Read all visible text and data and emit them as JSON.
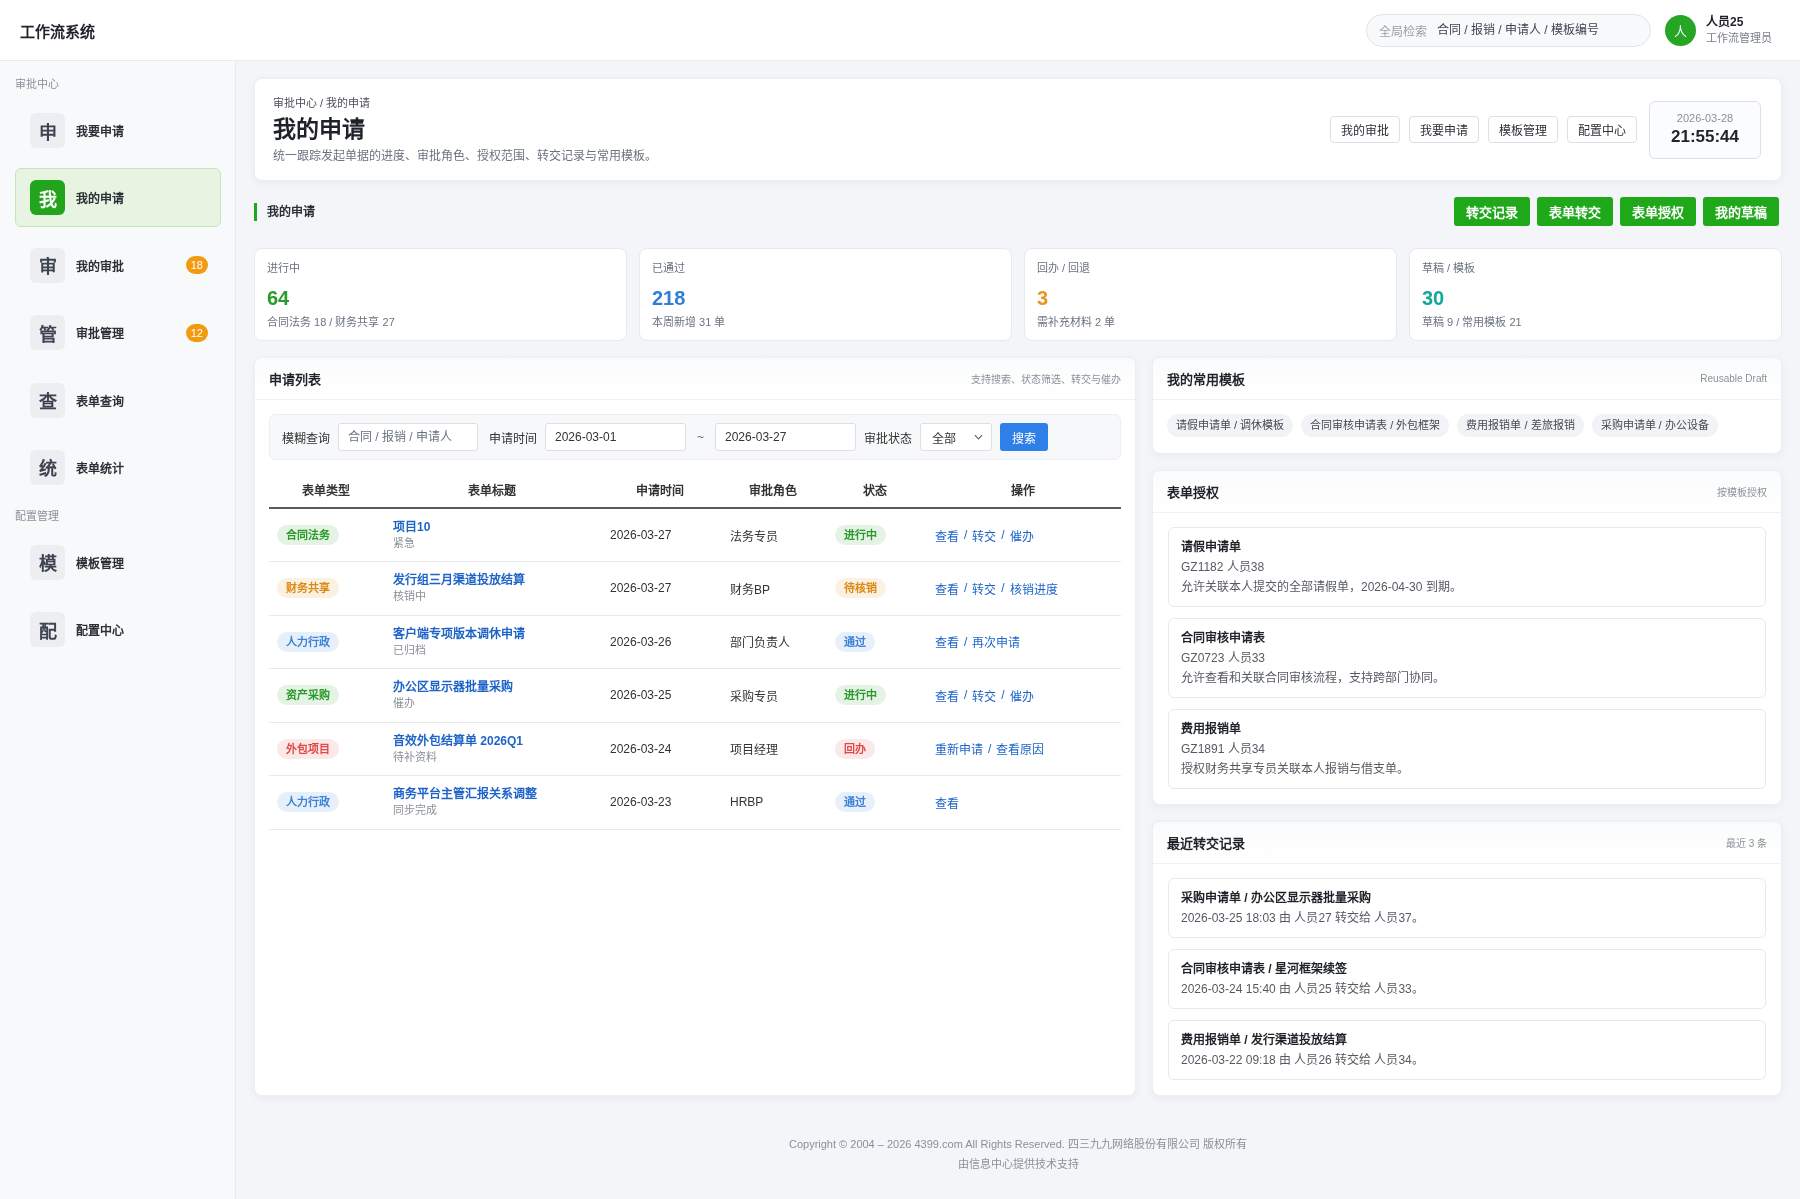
{
  "app": {
    "title": "工作流系统"
  },
  "global_search": {
    "label": "全局检索",
    "placeholder": "合同 / 报销 / 申请人 / 模板编号"
  },
  "user": {
    "avatar": "人",
    "name": "人员25",
    "role": "工作流管理员"
  },
  "sidebar": {
    "sections": [
      {
        "title": "审批中心",
        "items": [
          {
            "glyph": "申",
            "label": "我要申请",
            "selected": false
          },
          {
            "glyph": "我",
            "label": "我的申请",
            "selected": true
          },
          {
            "glyph": "审",
            "label": "我的审批",
            "badge": "18",
            "selected": false
          },
          {
            "glyph": "管",
            "label": "审批管理",
            "badge": "12",
            "selected": false
          },
          {
            "glyph": "查",
            "label": "表单查询",
            "selected": false
          },
          {
            "glyph": "统",
            "label": "表单统计",
            "selected": false
          }
        ]
      },
      {
        "title": "配置管理",
        "items": [
          {
            "glyph": "模",
            "label": "模板管理",
            "selected": false
          },
          {
            "glyph": "配",
            "label": "配置中心",
            "selected": false
          }
        ]
      }
    ]
  },
  "page_header": {
    "breadcrumb": "审批中心 / 我的申请",
    "title": "我的申请",
    "subtitle": "统一跟踪发起单据的进度、审批角色、授权范围、转交记录与常用模板。",
    "quick_links": [
      "我的审批",
      "我要申请",
      "模板管理",
      "配置中心"
    ],
    "clock": {
      "date": "2026-03-28",
      "time": "21:55:44"
    }
  },
  "section": {
    "title": "我的申请",
    "actions": [
      "转交记录",
      "表单转交",
      "表单授权",
      "我的草稿"
    ]
  },
  "stats": [
    {
      "label": "进行中",
      "value": "64",
      "note": "合同法务 18 / 财务共享 27",
      "color": "#2a9a2a"
    },
    {
      "label": "已通过",
      "value": "218",
      "note": "本周新增 31 单",
      "color": "#2f7fd6"
    },
    {
      "label": "回办 / 回退",
      "value": "3",
      "note": "需补充材料 2 单",
      "color": "#e8961e"
    },
    {
      "label": "草稿 / 模板",
      "value": "30",
      "note": "草稿 9 / 常用模板 21",
      "color": "#14a79a"
    }
  ],
  "application_list": {
    "title": "申请列表",
    "hint": "支持搜索、状态筛选、转交与催办",
    "filters": {
      "keyword_label": "模糊查询",
      "keyword_placeholder": "合同 / 报销 / 申请人",
      "date_label": "申请时间",
      "date_from": "2026-03-01",
      "range_separator": "~",
      "date_to": "2026-03-27",
      "status_label": "审批状态",
      "status_value": "全部",
      "search_button": "搜索"
    },
    "table": {
      "columns": [
        "表单类型",
        "表单标题",
        "申请时间",
        "审批角色",
        "状态",
        "操作"
      ],
      "action_separator": "/",
      "rows": [
        {
          "type": {
            "label": "合同法务",
            "color": "#2a9a2a"
          },
          "title": "项目10",
          "subtitle": "紧急",
          "date": "2026-03-27",
          "role": "法务专员",
          "status": {
            "label": "进行中",
            "color": "#2a9a2a"
          },
          "actions": [
            "查看",
            "转交",
            "催办"
          ]
        },
        {
          "type": {
            "label": "财务共享",
            "color": "#e08a16"
          },
          "title": "发行组三月渠道投放结算",
          "subtitle": "核销中",
          "date": "2026-03-27",
          "role": "财务BP",
          "status": {
            "label": "待核销",
            "color": "#e08a16"
          },
          "actions": [
            "查看",
            "转交",
            "核销进度"
          ]
        },
        {
          "type": {
            "label": "人力行政",
            "color": "#3b82d6"
          },
          "title": "客户端专项版本调休申请",
          "subtitle": "已归档",
          "date": "2026-03-26",
          "role": "部门负责人",
          "status": {
            "label": "通过",
            "color": "#3b82d6"
          },
          "actions": [
            "查看",
            "再次申请"
          ]
        },
        {
          "type": {
            "label": "资产采购",
            "color": "#2a9a2a"
          },
          "title": "办公区显示器批量采购",
          "subtitle": "催办",
          "date": "2026-03-25",
          "role": "采购专员",
          "status": {
            "label": "进行中",
            "color": "#2a9a2a"
          },
          "actions": [
            "查看",
            "转交",
            "催办"
          ]
        },
        {
          "type": {
            "label": "外包项目",
            "color": "#e04848"
          },
          "title": "音效外包结算单 2026Q1",
          "subtitle": "待补资料",
          "date": "2026-03-24",
          "role": "项目经理",
          "status": {
            "label": "回办",
            "color": "#e04848"
          },
          "actions": [
            "重新申请",
            "查看原因"
          ]
        },
        {
          "type": {
            "label": "人力行政",
            "color": "#3b82d6"
          },
          "title": "商务平台主管汇报关系调整",
          "subtitle": "同步完成",
          "date": "2026-03-23",
          "role": "HRBP",
          "status": {
            "label": "通过",
            "color": "#3b82d6"
          },
          "actions": [
            "查看"
          ]
        }
      ]
    }
  },
  "templates": {
    "title": "我的常用模板",
    "hint": "Reusable Draft",
    "chips": [
      "请假申请单 / 调休模板",
      "合同审核申请表 / 外包框架",
      "费用报销单 / 差旅报销",
      "采购申请单 / 办公设备"
    ]
  },
  "authorizations": {
    "title": "表单授权",
    "hint": "按模板授权",
    "items": [
      {
        "title": "请假申请单",
        "meta": "GZ1182 人员38",
        "description": "允许关联本人提交的全部请假单，2026-04-30 到期。"
      },
      {
        "title": "合同审核申请表",
        "meta": "GZ0723 人员33",
        "description": "允许查看和关联合同审核流程，支持跨部门协同。"
      },
      {
        "title": "费用报销单",
        "meta": "GZ1891 人员34",
        "description": "授权财务共享专员关联本人报销与借支单。"
      }
    ]
  },
  "transfers": {
    "title": "最近转交记录",
    "hint": "最近 3 条",
    "items": [
      {
        "title": "采购申请单 / 办公区显示器批量采购",
        "detail": "2026-03-25 18:03 由 人员27 转交给 人员37。"
      },
      {
        "title": "合同审核申请表 / 星河框架续签",
        "detail": "2026-03-24 15:40 由 人员25 转交给 人员33。"
      },
      {
        "title": "费用报销单 / 发行渠道投放结算",
        "detail": "2026-03-22 09:18 由 人员26 转交给 人员34。"
      }
    ]
  },
  "footer": {
    "lines": [
      "Copyright © 2004 – 2026 4399.com All Rights Reserved. 四三九九网络股份有限公司 版权所有",
      "由信息中心提供技术支持"
    ]
  }
}
